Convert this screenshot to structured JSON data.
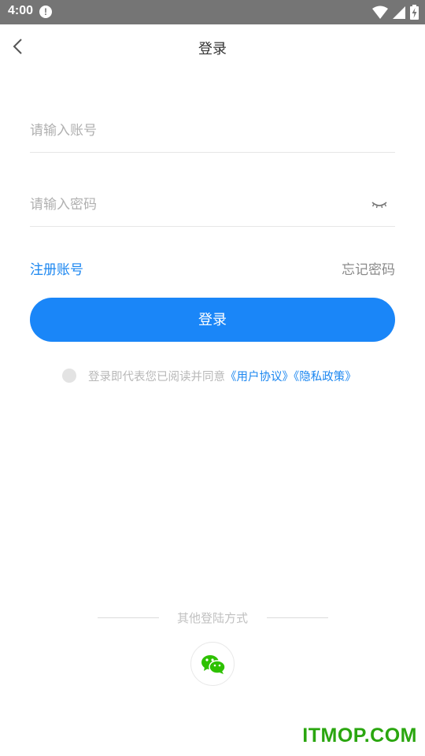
{
  "status_bar": {
    "time": "4:00",
    "icons": [
      "alert-icon",
      "wifi-icon",
      "signal-icon",
      "battery-charging-icon"
    ]
  },
  "nav": {
    "title": "登录",
    "back_icon": "chevron-left-icon"
  },
  "form": {
    "account_placeholder": "请输入账号",
    "account_value": "",
    "password_placeholder": "请输入密码",
    "password_value": "",
    "password_toggle_icon": "eye-closed-icon"
  },
  "links": {
    "register": "注册账号",
    "forgot": "忘记密码"
  },
  "login_button": "登录",
  "agreement": {
    "checked": false,
    "prefix": "登录即代表您已阅读并同意",
    "user_agreement": "《用户协议》",
    "privacy_policy": "《隐私政策》"
  },
  "other_login": {
    "label": "其他登陆方式",
    "wechat_icon": "wechat-icon"
  },
  "watermark": "ITMOP.COM",
  "colors": {
    "accent": "#1a86f8",
    "link": "#1a86f0",
    "status_bar": "#757575",
    "wechat": "#2dc100",
    "watermark": "#2aa60f"
  }
}
